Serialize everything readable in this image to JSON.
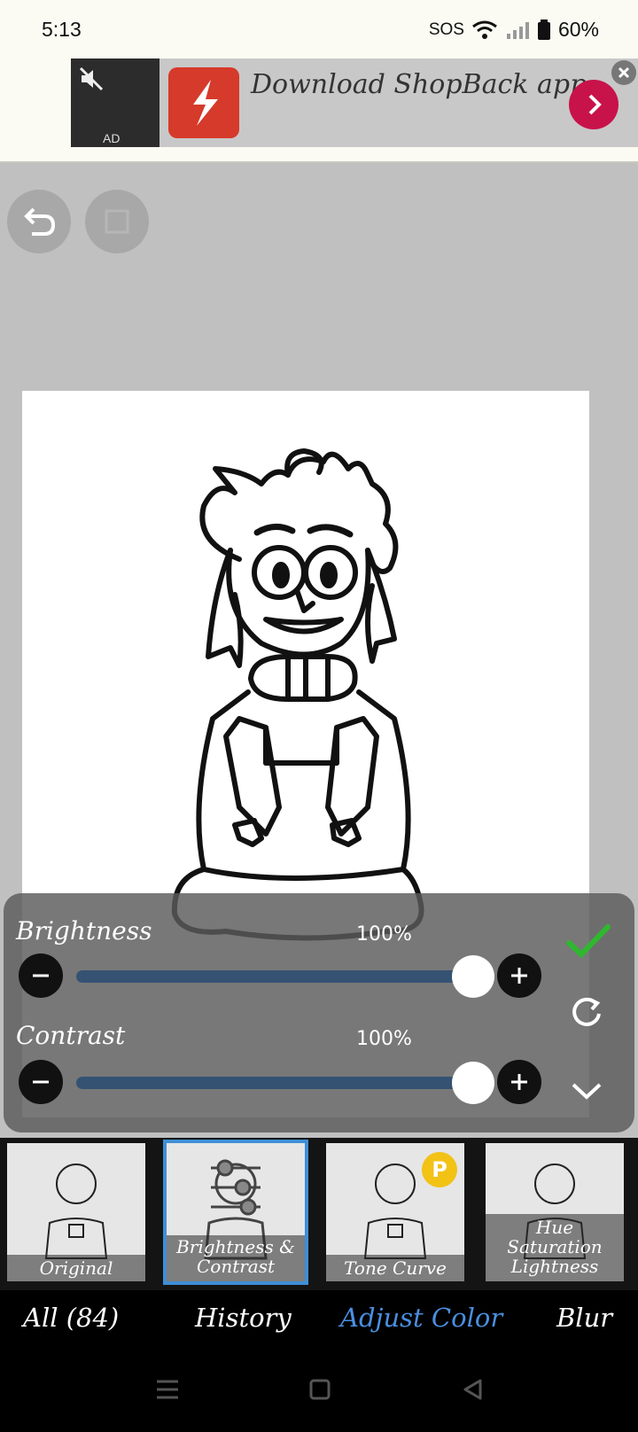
{
  "status_bar": {
    "time": "5:13",
    "sos": "SOS",
    "battery": "60%"
  },
  "ad": {
    "label": "AD",
    "text": "Download ShopBack app..."
  },
  "adjust_panel": {
    "brightness": {
      "label": "Brightness",
      "value": "100%",
      "fraction": 0.95
    },
    "contrast": {
      "label": "Contrast",
      "value": "100%",
      "fraction": 0.95
    },
    "colors": {
      "track": "#355273",
      "confirm": "#2eb82e"
    }
  },
  "filters": [
    {
      "label": "Original"
    },
    {
      "label": "Brightness & Contrast",
      "selected": true
    },
    {
      "label": "Tone Curve",
      "badge": "P"
    },
    {
      "label_lines": [
        "Hue",
        "Saturation",
        "Lightness"
      ]
    }
  ],
  "tabs": {
    "all": "All (84)",
    "history": "History",
    "adjust_color": "Adjust Color",
    "blur": "Blur"
  },
  "icons": [
    "undo-icon",
    "checkmark-icon",
    "reset-icon",
    "collapse-chevron-icon",
    "minus-icon",
    "plus-icon",
    "menu-icon",
    "home-icon",
    "back-icon"
  ]
}
